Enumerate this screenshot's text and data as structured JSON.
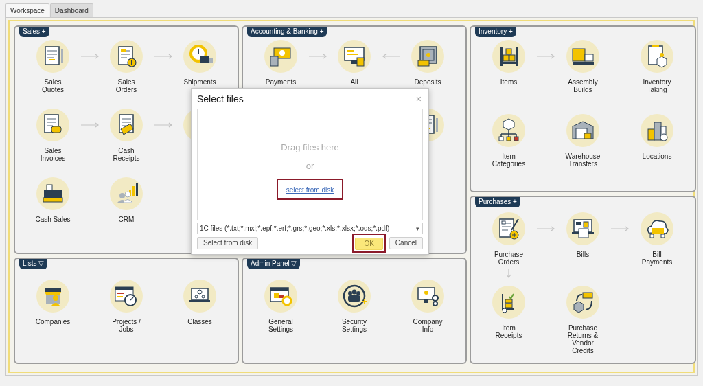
{
  "tabs": [
    {
      "label": "Workspace",
      "selected": true
    },
    {
      "label": "Dashboard",
      "selected": false
    }
  ],
  "panels": [
    {
      "title": "Sales",
      "toggle": "+",
      "rows": [
        [
          {
            "label": "Sales\nQuotes",
            "arrow_next": true
          },
          {
            "label": "Sales\nOrders",
            "arrow_next": true
          },
          {
            "label": "Shipments"
          }
        ],
        [
          {
            "label": "Sales\nInvoices",
            "arrow_next": true
          },
          {
            "label": "Cash\nReceipts",
            "arrow_next": true
          },
          {}
        ],
        [
          {
            "label": "Cash Sales"
          },
          {
            "label": "CRM"
          }
        ]
      ]
    },
    {
      "title": "Accounting & Banking",
      "toggle": "+",
      "rows": [
        [
          {
            "label": "Payments",
            "arrow_next": true
          },
          {
            "label": "All",
            "arrow_back": true
          },
          {
            "label": "Deposits"
          }
        ],
        [
          null,
          null,
          {}
        ]
      ]
    },
    {
      "title": "Inventory",
      "toggle": "+",
      "rows": [
        [
          {
            "label": "Items",
            "arrow_next": true
          },
          {
            "label": "Assembly\nBuilds"
          },
          {
            "label": "Inventory\nTaking"
          }
        ],
        [
          {
            "label": "Item\nCategories"
          },
          {
            "label": "Warehouse\nTransfers"
          },
          {
            "label": "Locations"
          }
        ]
      ]
    },
    {
      "title": "Purchases",
      "toggle": "+",
      "rows": [
        [
          {
            "label": "Purchase\nOrders",
            "arrow_next": true,
            "down": true
          },
          {
            "label": "Bills",
            "arrow_next": true
          },
          {
            "label": "Bill\nPayments"
          }
        ],
        [
          {
            "label": "Item\nReceipts"
          },
          {
            "label": "Purchase\nReturns &\nVendor\nCredits"
          }
        ]
      ]
    },
    {
      "title": "Lists",
      "toggle": "▽",
      "rows": [
        [
          {
            "label": "Companies"
          },
          {
            "label": "Projects /\nJobs"
          },
          {
            "label": "Classes"
          }
        ]
      ]
    },
    {
      "title": "Admin Panel",
      "toggle": "▽",
      "rows": [
        [
          {
            "label": "General\nSettings"
          },
          {
            "label": "Security\nSettings"
          },
          {
            "label": "Company\nInfo"
          }
        ]
      ]
    }
  ],
  "dialog": {
    "title": "Select files",
    "close": "×",
    "drop_text": "Drag files here",
    "or_text": "or",
    "link": {
      "label": "select from disk",
      "highlighted": true
    },
    "filter": {
      "value": "1C files (*.txt;*.mxl;*.epf;*.erf;*.grs;*.geo;*.xls;*.xlsx;*.ods;*.pdf)",
      "arrow": "▾"
    },
    "buttons": [
      {
        "label": "Select from disk",
        "kind": "default"
      },
      {
        "label": "OK",
        "kind": "primary",
        "highlighted": true
      },
      {
        "label": "Cancel",
        "kind": "default"
      }
    ]
  }
}
